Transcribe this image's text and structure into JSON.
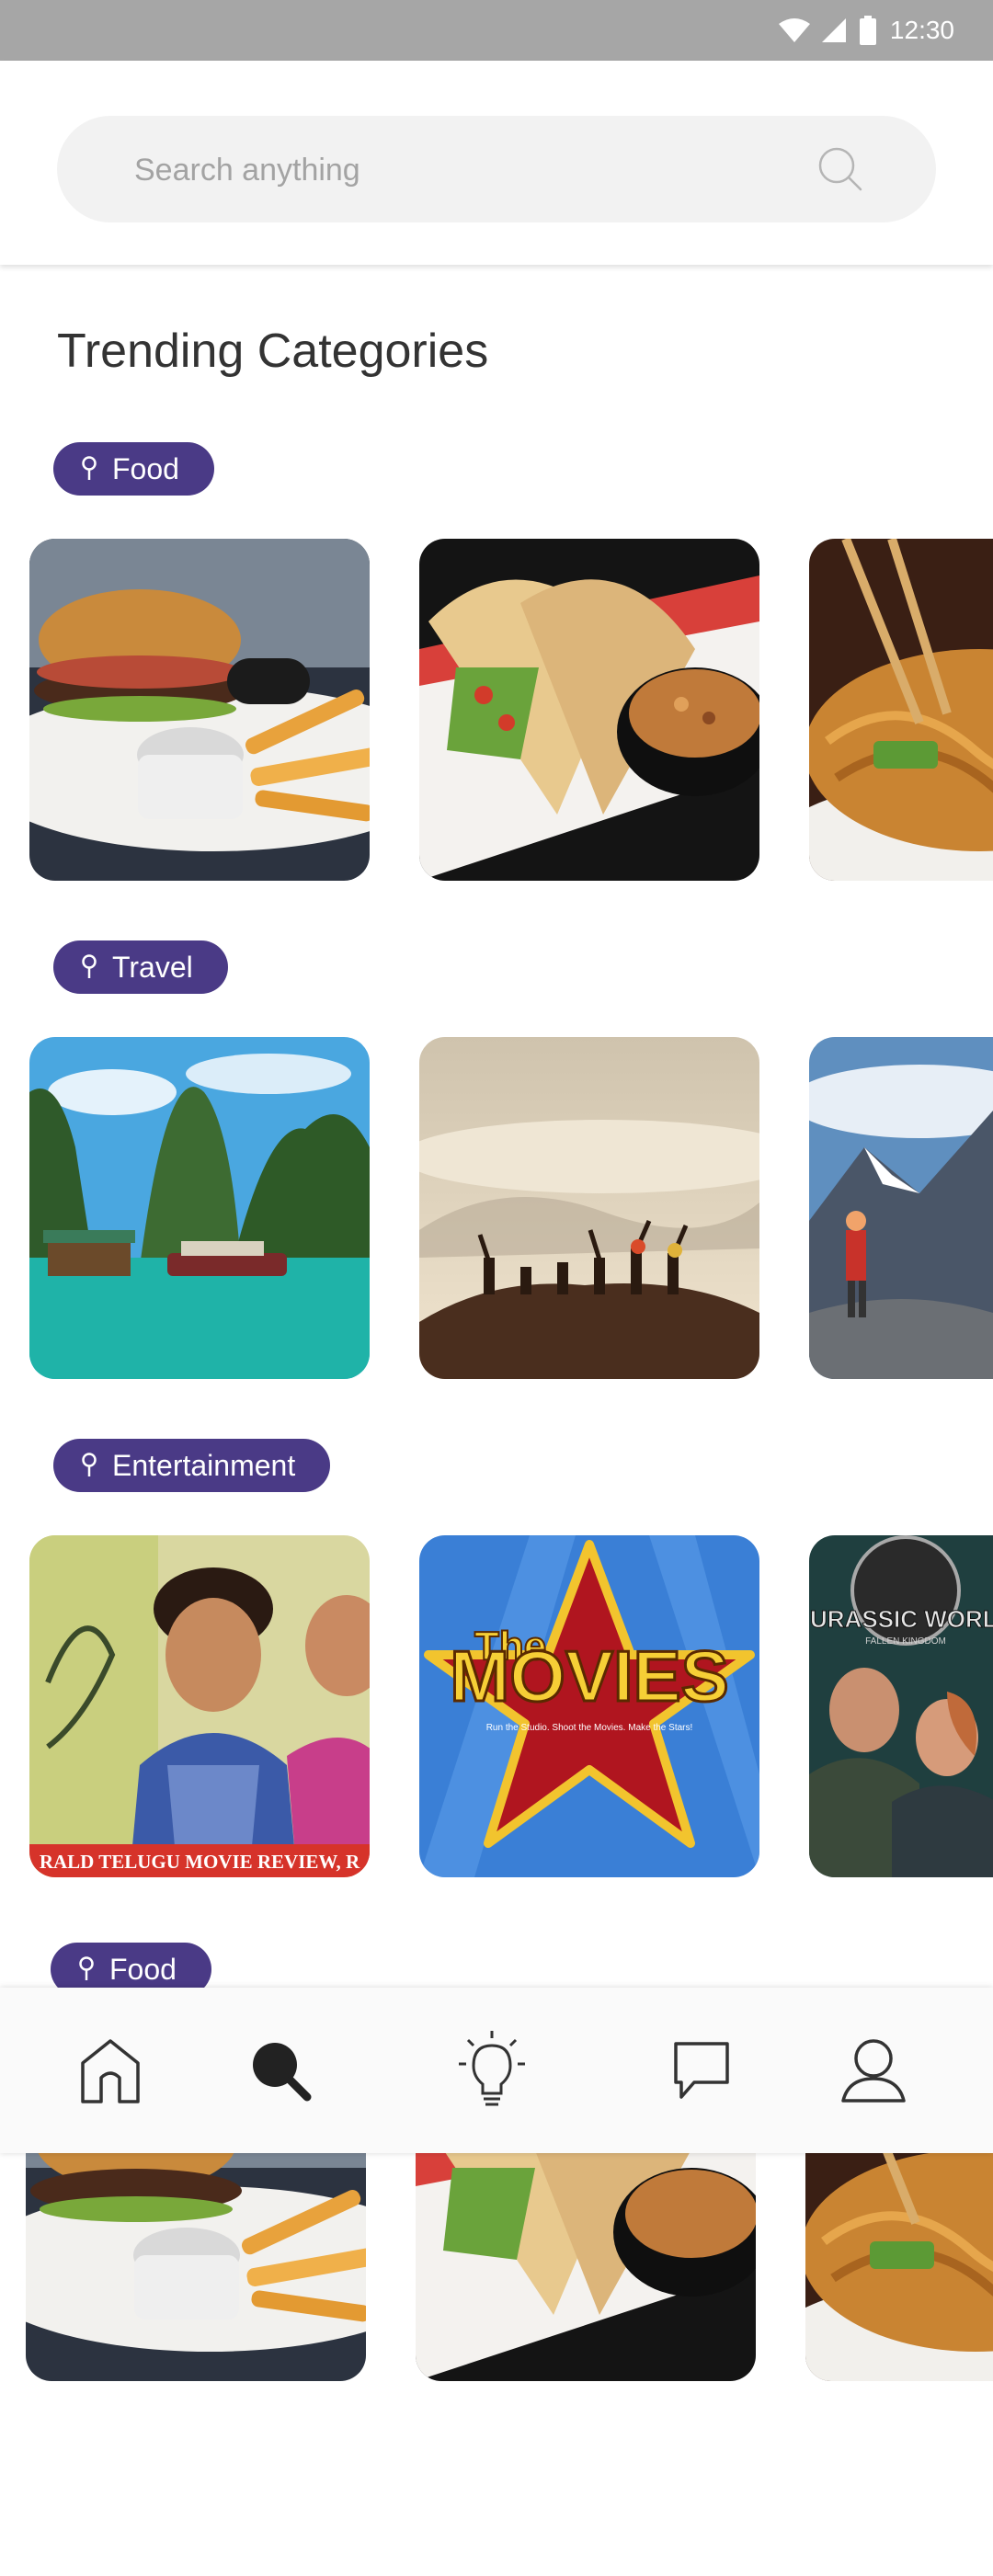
{
  "status_bar": {
    "time": "12:30"
  },
  "search": {
    "placeholder": "Search anything"
  },
  "section_title": "Trending Categories",
  "categories": [
    {
      "label": "Food",
      "tiles": [
        "burger-fries-photo",
        "tacos-photo",
        "noodles-photo"
      ]
    },
    {
      "label": "Travel",
      "tiles": [
        "bay-karst-boats-photo",
        "hilltop-group-photo",
        "mountain-hiker-photo"
      ]
    },
    {
      "label": "Entertainment",
      "tiles": [
        "telugu-movie-poster",
        "the-movies-poster",
        "jurassic-world-poster"
      ]
    },
    {
      "label": "Food",
      "tiles": [
        "burger-fries-photo",
        "tacos-photo",
        "noodles-photo"
      ]
    }
  ],
  "posters": {
    "telugu_banner": "RALD TELUGU MOVIE REVIEW, R",
    "the_movies_line1": "The",
    "the_movies_line2": "MOVIES",
    "the_movies_tagline": "Run the Studio. Shoot the Movies. Make the Stars!",
    "jurassic_title": "JURASSIC WORLD",
    "jurassic_subtitle": "FALLEN KINGDOM"
  },
  "bottom_nav": {
    "items": [
      "home-icon",
      "search-icon",
      "lightbulb-icon",
      "chat-icon",
      "profile-icon"
    ],
    "active": "search-icon"
  },
  "colors": {
    "chip": "#4a3a86",
    "status_bar": "#a6a6a6",
    "search_bg": "#f2f2f2"
  }
}
